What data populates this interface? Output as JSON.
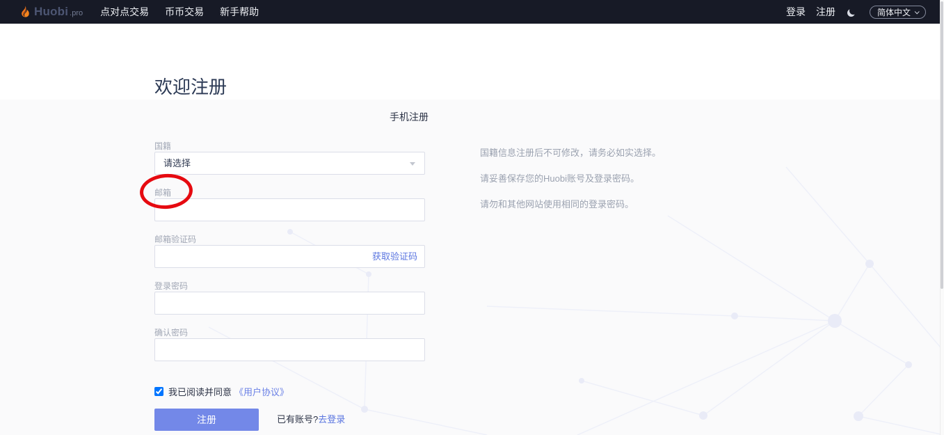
{
  "navbar": {
    "logo": {
      "brand": "Huobi",
      "suffix": ".pro"
    },
    "items": [
      {
        "label": "点对点交易"
      },
      {
        "label": "币币交易"
      },
      {
        "label": "新手帮助"
      }
    ],
    "right": {
      "login": "登录",
      "register": "注册",
      "language": "简体中文"
    }
  },
  "page": {
    "title": "欢迎注册",
    "tab": "手机注册"
  },
  "form": {
    "nationality": {
      "label": "国籍",
      "placeholder": "请选择"
    },
    "email": {
      "label": "邮箱",
      "value": ""
    },
    "email_code": {
      "label": "邮箱验证码",
      "value": "",
      "action": "获取验证码"
    },
    "password": {
      "label": "登录密码",
      "value": ""
    },
    "confirm_password": {
      "label": "确认密码",
      "value": ""
    },
    "agreement": {
      "checked": true,
      "text": "我已阅读并同意",
      "link": "《用户协议》"
    },
    "submit_label": "注册",
    "login_hint": {
      "text": "已有账号?",
      "link": "去登录"
    }
  },
  "hints": [
    "国籍信息注册后不可修改，请务必如实选择。",
    "请妥善保存您的Huobi账号及登录密码。",
    "请勿和其他网站使用相同的登录密码。"
  ],
  "colors": {
    "navbar_bg": "#171a26",
    "accent": "#7388e8",
    "link": "#5b76e0",
    "flame": "#f6851e",
    "annotation": "#e60a10"
  }
}
